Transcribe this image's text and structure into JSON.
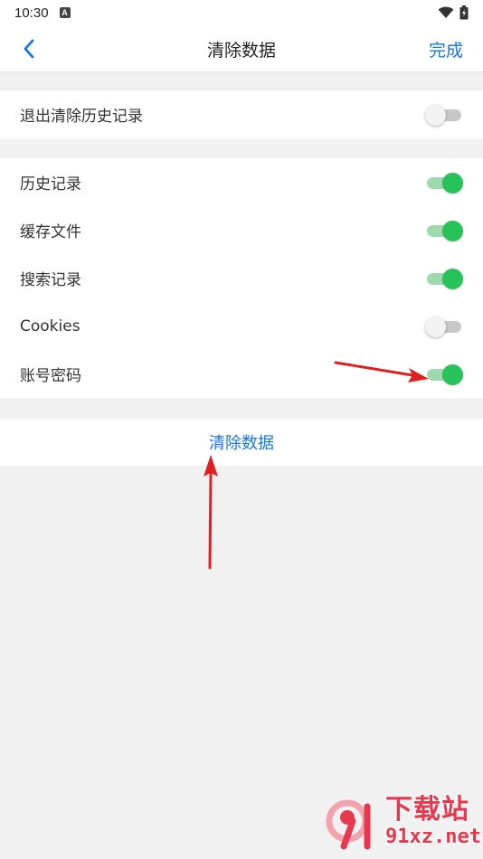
{
  "status_bar": {
    "time": "10:30",
    "notification_icon": "a-icon",
    "wifi_icon": "wifi-icon",
    "battery_icon": "battery-charging-icon"
  },
  "nav": {
    "back_icon": "chevron-left-icon",
    "title": "清除数据",
    "done_label": "完成"
  },
  "settings": {
    "exit_group": [
      {
        "label": "退出清除历史记录",
        "enabled": false
      }
    ],
    "items": [
      {
        "label": "历史记录",
        "enabled": true
      },
      {
        "label": "缓存文件",
        "enabled": true
      },
      {
        "label": "搜索记录",
        "enabled": true
      },
      {
        "label": "Cookies",
        "enabled": false
      },
      {
        "label": "账号密码",
        "enabled": true
      }
    ]
  },
  "action": {
    "clear_label": "清除数据"
  },
  "colors": {
    "accent": "#1677e6",
    "toggle_on": "#27c35a",
    "toggle_off": "#c8c8c8",
    "annotation_arrow": "#e02020",
    "background": "#f1f1f1"
  },
  "watermark": {
    "line1": "下载站",
    "line2": "91xz.net"
  }
}
